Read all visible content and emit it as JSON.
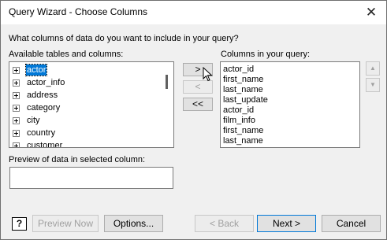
{
  "window": {
    "title": "Query Wizard - Choose Columns",
    "close_glyph": "✕"
  },
  "prompt": "What columns of data do you want to include in your query?",
  "available": {
    "label": "Available tables and columns:",
    "items": [
      "actor",
      "actor_info",
      "address",
      "category",
      "city",
      "country",
      "customer"
    ],
    "selected": "actor"
  },
  "columns": {
    "label": "Columns in your query:",
    "items": [
      "actor_id",
      "first_name",
      "last_name",
      "last_update",
      "actor_id",
      "film_info",
      "first_name",
      "last_name"
    ]
  },
  "transfer": {
    "add_one": ">",
    "remove_one": "<",
    "remove_all": "<<"
  },
  "order": {
    "up_glyph": "▲",
    "down_glyph": "▼"
  },
  "preview": {
    "label": "Preview of data in selected column:",
    "value": ""
  },
  "footer": {
    "help_glyph": "?",
    "preview_now": "Preview Now",
    "options": "Options...",
    "back": "< Back",
    "next": "Next >",
    "cancel": "Cancel"
  },
  "icons": {
    "close": "close-icon",
    "expand": "plus-box-icon",
    "help": "help-icon",
    "cursor": "mouse-pointer-icon"
  }
}
